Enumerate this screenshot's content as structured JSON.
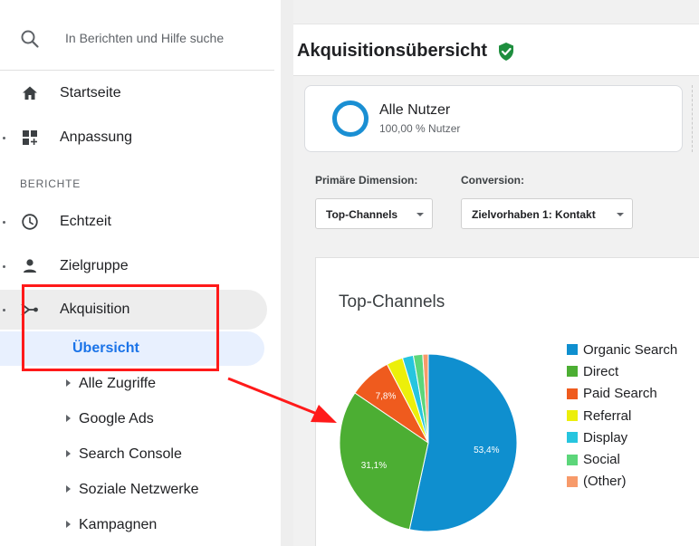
{
  "search": {
    "placeholder": "In Berichten und Hilfe suche"
  },
  "sidebar": {
    "top_items": [
      {
        "label": "Startseite",
        "icon": "home-icon"
      },
      {
        "label": "Anpassung",
        "icon": "dashboard-icon"
      }
    ],
    "section_heading": "BERICHTE",
    "report_items": [
      {
        "label": "Echtzeit",
        "icon": "clock-icon"
      },
      {
        "label": "Zielgruppe",
        "icon": "person-icon"
      },
      {
        "label": "Akquisition",
        "icon": "acquisition-icon"
      }
    ],
    "acquisition_children": [
      {
        "label": "Übersicht",
        "active": true
      },
      {
        "label": "Alle Zugriffe"
      },
      {
        "label": "Google Ads"
      },
      {
        "label": "Search Console"
      },
      {
        "label": "Soziale Netzwerke"
      },
      {
        "label": "Kampagnen"
      }
    ]
  },
  "header": {
    "title": "Akquisitionsübersicht",
    "verified_icon": "verified-shield-icon"
  },
  "segment": {
    "name": "Alle Nutzer",
    "subtitle": "100,00 % Nutzer"
  },
  "controls": {
    "primary_dimension": {
      "label": "Primäre Dimension:",
      "value": "Top-Channels"
    },
    "conversion": {
      "label": "Conversion:",
      "value": "Zielvorhaben 1: Kontakt"
    }
  },
  "colors": {
    "accent": "#1a73e8",
    "highlight": "#ff1a1a",
    "verified": "#1e8e3e"
  },
  "chart_data": {
    "type": "pie",
    "title": "Top-Channels",
    "legend_position": "right",
    "slices": [
      {
        "name": "Organic Search",
        "value": 53.4,
        "label": "53,4%",
        "color": "#0f8fcf"
      },
      {
        "name": "Direct",
        "value": 31.1,
        "label": "31,1%",
        "color": "#4cae33"
      },
      {
        "name": "Paid Search",
        "value": 7.8,
        "label": "7,8%",
        "color": "#ef5b1e"
      },
      {
        "name": "Referral",
        "value": 3.0,
        "label": "",
        "color": "#ecef0a"
      },
      {
        "name": "Display",
        "value": 2.0,
        "label": "",
        "color": "#26c5df"
      },
      {
        "name": "Social",
        "value": 1.7,
        "label": "",
        "color": "#5cd67a"
      },
      {
        "name": "(Other)",
        "value": 1.0,
        "label": "",
        "color": "#f79a6a"
      }
    ]
  }
}
